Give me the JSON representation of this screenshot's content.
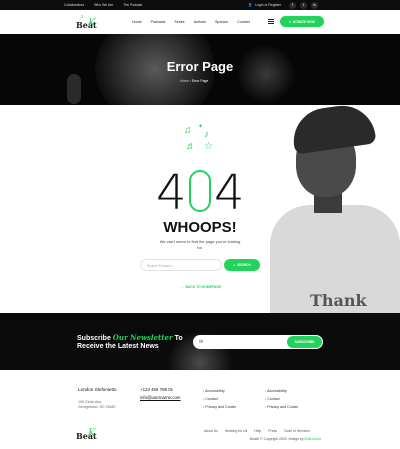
{
  "topbar": {
    "links": [
      "Collaborators",
      "Who We Are",
      "The Podcast"
    ],
    "login": "Login or Register",
    "social": [
      "f",
      "t",
      "in"
    ]
  },
  "header": {
    "logo_text": "Beat",
    "logo_mark": "K",
    "nav": [
      "Home",
      "Podcasts",
      "Series",
      "Authors",
      "Sponsor",
      "Contact"
    ],
    "donate_label": "DONATE NOW"
  },
  "hero": {
    "title": "Error Page",
    "breadcrumb_home": "Home",
    "breadcrumb_sep": " / ",
    "breadcrumb_current": "Error Page"
  },
  "error": {
    "digit_left": "4",
    "digit_right": "4",
    "heading": "WHOOPS!",
    "message": "We can't seem to find the page you're looking for.",
    "search_placeholder": "Search Podcast...",
    "search_button": "SEARCH",
    "back_label": "BACK TO HOMEPAGE",
    "back_prefix": "←"
  },
  "person": {
    "shirt_text": "Thank"
  },
  "newsletter": {
    "line1_a": "Subscribe ",
    "line1_em": "Our Newsletter",
    "line1_b": " To",
    "line2": "Receive the Latest News",
    "input_icon": "✉",
    "subscribe_label": "SUBSCRIBE"
  },
  "footer": {
    "city": "London Stefonietto",
    "address_1": "109 Circle Ave,",
    "address_2": "Georgetown, SC 29440",
    "phone": "+123 456 789 01",
    "email": "info@username.com",
    "col1": [
      "Accessibility",
      "Contact",
      "Privacy and Cookie"
    ],
    "col2": [
      "Accessibility",
      "Contact",
      "Privacy and Cookie"
    ],
    "links": [
      "About Us",
      "Working for Us",
      "Help",
      "Press",
      "Code of Services"
    ],
    "copy_prefix": "BeatK © Copyright 2020. Design by ",
    "copy_brand": "Bolboridea"
  },
  "colors": {
    "accent": "#22d35b",
    "dark": "#0b0b0b"
  },
  "icons": [
    "music-note-icon",
    "star-icon",
    "search-icon",
    "arrow-left-icon",
    "mail-icon",
    "menu-icon",
    "user-icon",
    "heart-icon",
    "facebook-icon",
    "twitter-icon",
    "linkedin-icon"
  ]
}
